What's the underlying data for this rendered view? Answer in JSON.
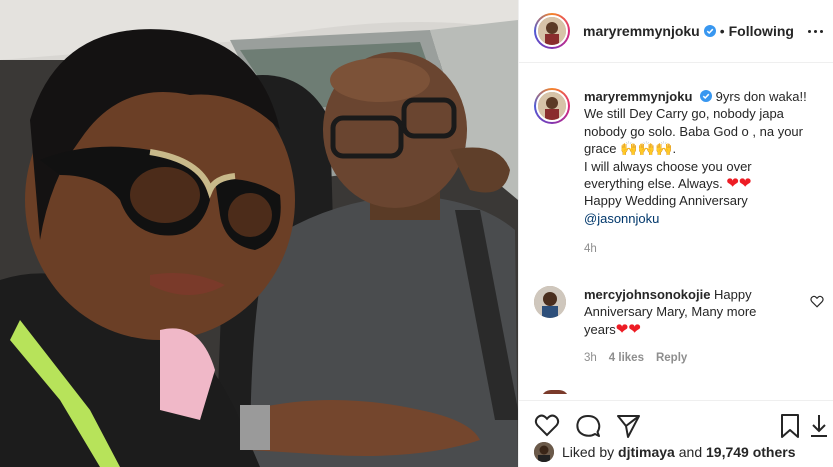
{
  "post": {
    "author": "maryremmynjoku",
    "follow_separator": "•",
    "follow_status": "Following"
  },
  "caption": {
    "author": "maryremmynjoku",
    "line1": "9yrs don waka!!",
    "line2": "We still Dey Carry go, nobody japa",
    "line3": "nobody go solo. Baba God o , na your",
    "line4": "grace",
    "line4_emoji": "🙌🙌🙌",
    "line4_end": ".",
    "line5": "I will always choose you over",
    "line6": "everything else. Always.",
    "line6_emoji": "❤❤",
    "line7": "Happy Wedding Anniversary",
    "mention": "@jasonnjoku",
    "time": "4h"
  },
  "comment": {
    "author": "mercyjohnsonokojie",
    "text1": "Happy",
    "text2": "Anniversary Mary, Many more",
    "text3": "years",
    "emoji": "❤❤",
    "time": "3h",
    "likes": "4 likes",
    "reply": "Reply"
  },
  "likes": {
    "prefix": "Liked by",
    "user": "djtimaya",
    "mid": "and",
    "count": "19,749 others"
  },
  "icons": [
    "heart-icon",
    "comment-icon",
    "share-icon",
    "bookmark-icon",
    "verified-icon",
    "more-icon"
  ],
  "colors": {
    "verified": "#3897f0",
    "text": "#262626",
    "muted": "#8e8e8e",
    "mention": "#00376b",
    "border": "#efefef"
  }
}
